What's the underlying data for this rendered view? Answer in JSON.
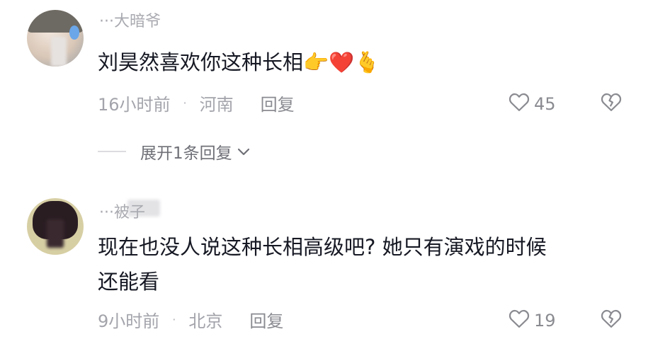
{
  "comments": [
    {
      "username": "···大暗爷",
      "text": "刘昊然喜欢你这种长相👉❤️🫰",
      "time": "16小时前",
      "location": "河南",
      "reply_label": "回复",
      "likes": "45",
      "expand_label": "展开1条回复"
    },
    {
      "username": "···被子",
      "text_line1": "现在也没人说这种长相高级吧? 她只有演戏的时候",
      "text_line2": "还能看",
      "time": "9小时前",
      "location": "北京",
      "reply_label": "回复",
      "likes": "19"
    }
  ],
  "separator": "·",
  "icons": {
    "like": "heart-outline-icon",
    "dislike": "broken-heart-icon",
    "expand": "chevron-down-icon"
  },
  "colors": {
    "text": "#161823",
    "meta": "#a3a4ab",
    "username": "#a9aab0"
  }
}
